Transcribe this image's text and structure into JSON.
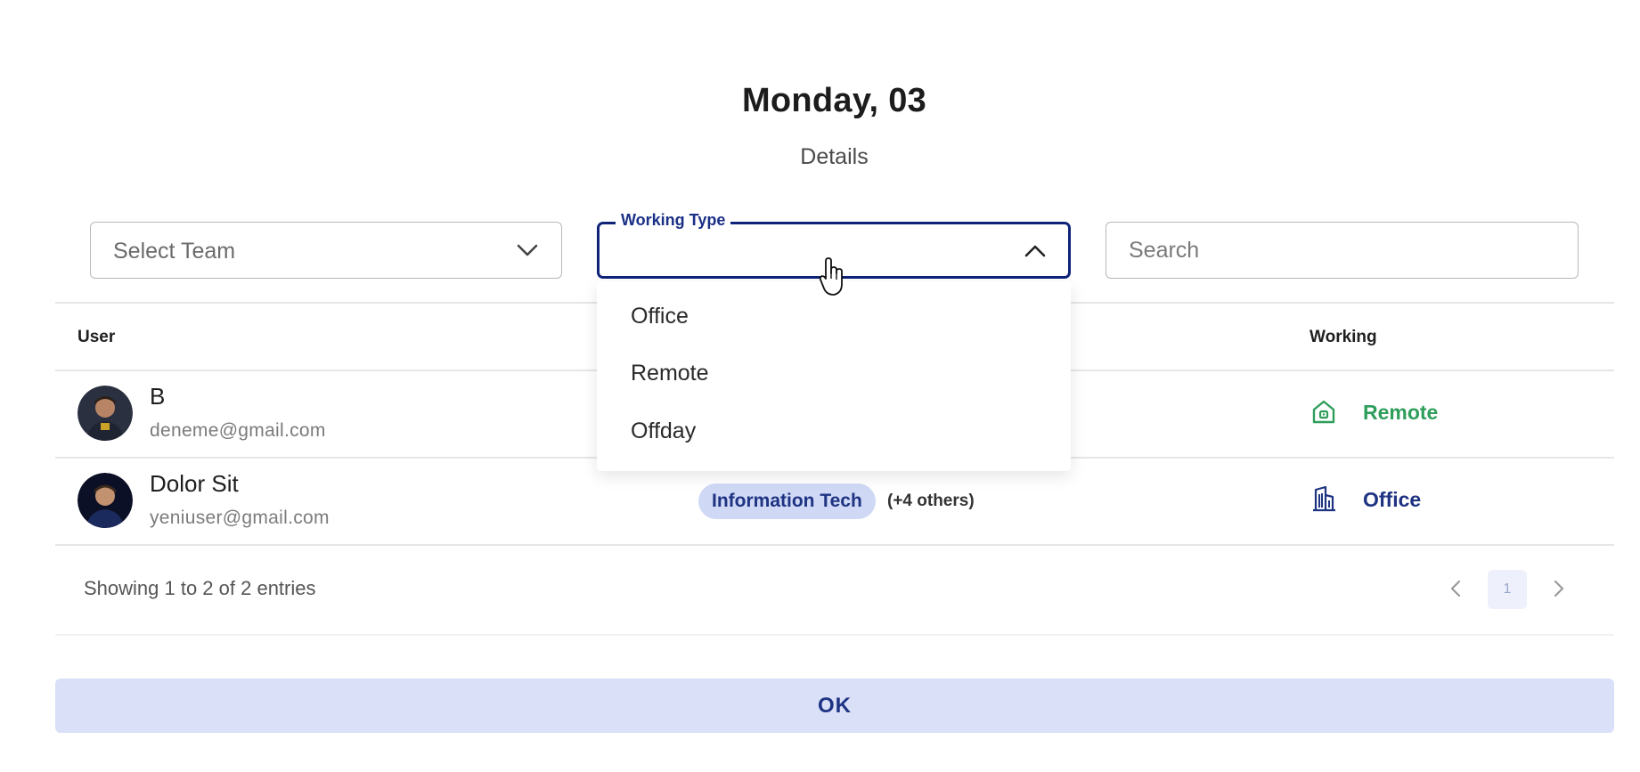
{
  "dialog": {
    "title": "Monday, 03",
    "subtitle": "Details"
  },
  "filters": {
    "team": {
      "placeholder": "Select Team",
      "icon": "chevron-down-icon"
    },
    "working_type": {
      "label": "Working Type",
      "value": "",
      "icon": "chevron-up-icon",
      "open": true
    },
    "search": {
      "placeholder": "Search",
      "value": ""
    }
  },
  "dropdown": {
    "options": [
      "Office",
      "Remote",
      "Offday"
    ]
  },
  "table": {
    "columns": {
      "user": "User",
      "working": "Working"
    },
    "rows": [
      {
        "name": "B",
        "email": "deneme@gmail.com",
        "working": "Remote",
        "working_icon": "home-icon",
        "working_color": "#2f9e5b"
      },
      {
        "name": "Dolor Sit",
        "email": "yeniuser@gmail.com",
        "department": "Information Tech",
        "department_more": "(+4 others)",
        "working": "Office",
        "working_icon": "building-icon",
        "working_color": "#1e3382"
      }
    ]
  },
  "pagination": {
    "summary": "Showing 1 to 2 of 2 entries",
    "current_page": "1"
  },
  "actions": {
    "ok_label": "OK"
  },
  "colors": {
    "accent": "#0f2478",
    "remote_green": "#2f9e5b",
    "office_navy": "#1e3382",
    "chip_bg": "#cfd8f5",
    "ok_bg": "#d9e0f7"
  }
}
